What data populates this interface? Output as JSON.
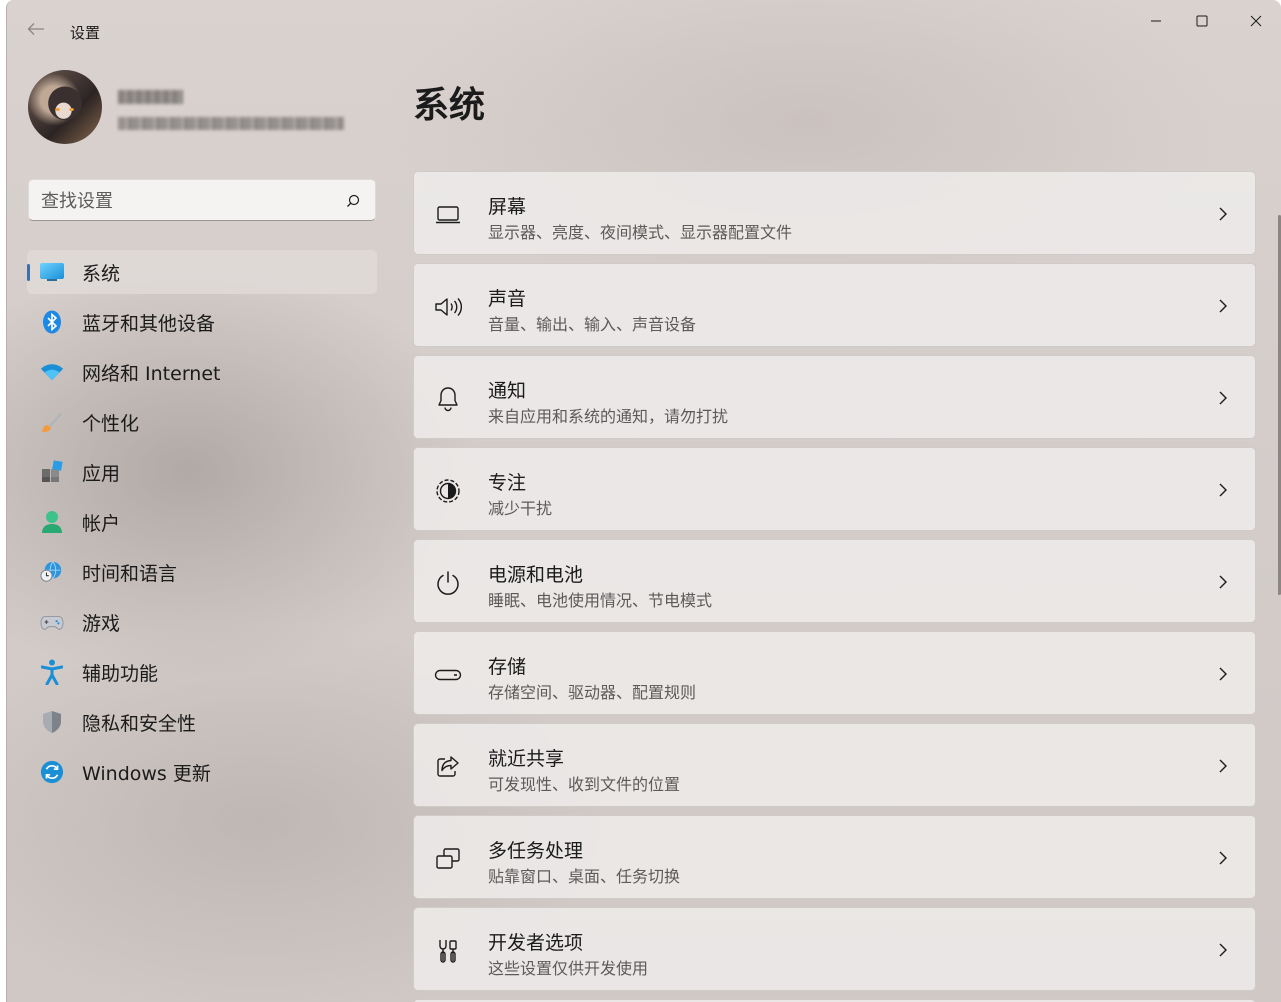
{
  "window": {
    "title": "设置"
  },
  "profile": {
    "name": "▇▇▇ ▇",
    "email": "▇▇▇▇▇▇▇▇▇▇▇▇▇▇▇▇▇▇"
  },
  "search": {
    "placeholder": "查找设置"
  },
  "nav": {
    "active_index": 0,
    "items": [
      {
        "label": "系统",
        "icon": "system-display-icon"
      },
      {
        "label": "蓝牙和其他设备",
        "icon": "bluetooth-icon"
      },
      {
        "label": "网络和 Internet",
        "icon": "wifi-icon"
      },
      {
        "label": "个性化",
        "icon": "paintbrush-icon"
      },
      {
        "label": "应用",
        "icon": "apps-icon"
      },
      {
        "label": "帐户",
        "icon": "account-icon"
      },
      {
        "label": "时间和语言",
        "icon": "time-language-icon"
      },
      {
        "label": "游戏",
        "icon": "gamepad-icon"
      },
      {
        "label": "辅助功能",
        "icon": "accessibility-icon"
      },
      {
        "label": "隐私和安全性",
        "icon": "shield-icon"
      },
      {
        "label": "Windows 更新",
        "icon": "windows-update-icon"
      }
    ]
  },
  "main": {
    "title": "系统",
    "cards": [
      {
        "title": "屏幕",
        "desc": "显示器、亮度、夜间模式、显示器配置文件",
        "icon": "monitor-icon"
      },
      {
        "title": "声音",
        "desc": "音量、输出、输入、声音设备",
        "icon": "speaker-icon"
      },
      {
        "title": "通知",
        "desc": "来自应用和系统的通知，请勿打扰",
        "icon": "bell-icon"
      },
      {
        "title": "专注",
        "desc": "减少干扰",
        "icon": "focus-icon"
      },
      {
        "title": "电源和电池",
        "desc": "睡眠、电池使用情况、节电模式",
        "icon": "power-icon"
      },
      {
        "title": "存储",
        "desc": "存储空间、驱动器、配置规则",
        "icon": "storage-icon"
      },
      {
        "title": "就近共享",
        "desc": "可发现性、收到文件的位置",
        "icon": "share-icon"
      },
      {
        "title": "多任务处理",
        "desc": "贴靠窗口、桌面、任务切换",
        "icon": "multitasking-icon"
      },
      {
        "title": "开发者选项",
        "desc": "这些设置仅供开发使用",
        "icon": "developer-tools-icon"
      }
    ]
  },
  "colors": {
    "accent": "#3f6fa8",
    "text": "#1b1b1b",
    "secondary_text": "#5d5a59"
  }
}
